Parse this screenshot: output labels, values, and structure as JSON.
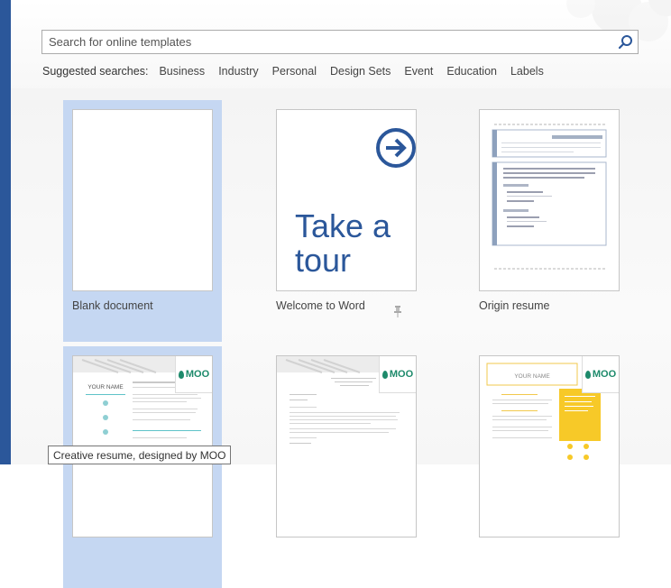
{
  "search": {
    "placeholder": "Search for online templates"
  },
  "suggested": {
    "label": "Suggested searches:",
    "links": [
      "Business",
      "Industry",
      "Personal",
      "Design Sets",
      "Event",
      "Education",
      "Labels"
    ]
  },
  "templates": [
    {
      "label": "Blank document",
      "selected": true
    },
    {
      "label": "Welcome to Word",
      "thumb_text": "Take a tour",
      "pinned": true
    },
    {
      "label": "Origin resume"
    },
    {
      "label": "",
      "badge": "MOO",
      "resume_name": "YOUR NAME"
    },
    {
      "label": "",
      "badge": "MOO"
    },
    {
      "label": "",
      "badge": "MOO",
      "resume_name": "YOUR NAME"
    }
  ],
  "tour_lines": [
    "Take a",
    "tour"
  ],
  "tooltip": "Creative resume, designed by MOO",
  "colors": {
    "accent": "#2b579a",
    "selection": "#c5d7f2",
    "moo_green": "#1d8a6b",
    "resume_yellow": "#f7c928"
  }
}
